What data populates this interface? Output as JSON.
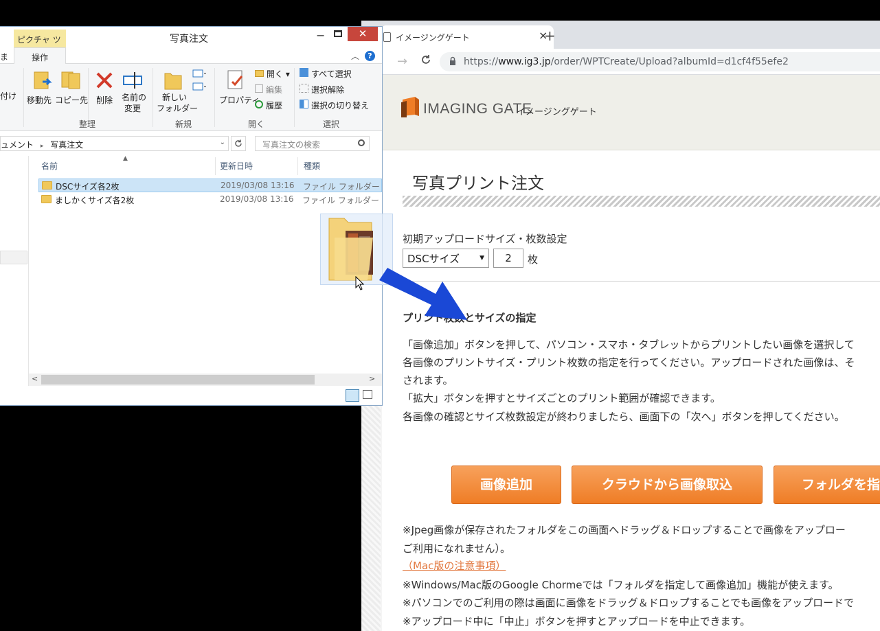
{
  "browser": {
    "tab_title": "イメージングゲート",
    "tab_close": "×",
    "new_tab": "+",
    "nav_back": "←",
    "nav_forward": "→",
    "nav_reload": "C",
    "url_scheme": "https://",
    "url_host": "www.ig3.jp",
    "url_path": "/order/WPTCreate/Upload?albumId=d1cf4f55efe2"
  },
  "site": {
    "logo_text": "IMAGING GATE",
    "logo_sub": "イメージングゲート",
    "page_title": "写真プリント注文",
    "upload_label": "初期アップロードサイズ・枚数設定",
    "size_value": "DSCサイズ",
    "count_value": "2",
    "count_unit": "枚",
    "section_heading": "プリント枚数とサイズの指定",
    "desc_lines": [
      "「画像追加」ボタンを押して、パソコン・スマホ・タブレットからプリントしたい画像を選択して",
      "各画像のプリントサイズ・プリント枚数の指定を行ってください。アップロードされた画像は、そ",
      "されます。",
      "「拡大」ボタンを押すとサイズごとのプリント範囲が確認できます。",
      "各画像の確認とサイズ枚数設定が終わりましたら、画面下の「次へ」ボタンを押してください。"
    ],
    "buttons": {
      "add_image": "画像追加",
      "cloud_import": "クラウドから画像取込",
      "folder_add": "フォルダを指"
    },
    "notes": [
      "※Jpeg画像が保存されたフォルダをこの画面へドラッグ＆ドロップすることで画像をアップロー",
      "ご利用になれません）。",
      "※Windows/Mac版のGoogle Chormeでは「フォルダを指定して画像追加」機能が使えます。",
      "※パソコンでのご利用の際は画面に画像をドラッグ＆ドロップすることでも画像をアップロードで",
      "※アップロード中に「中止」ボタンを押すとアップロードを中止できます。"
    ],
    "mac_link": "（Mac版の注意事項）"
  },
  "explorer": {
    "contextual_tab": "ピクチャ ツール",
    "title": "写真注文",
    "min": "−",
    "close": "✕",
    "tab_file_stub": "ま",
    "tab_manage": "操作",
    "help": "?",
    "ribbon": {
      "paste_stub": "付け",
      "move_to": "移動先",
      "copy_to": "コピー先",
      "delete": "削除",
      "rename_1": "名前の",
      "rename_2": "変更",
      "new_folder_1": "新しい",
      "new_folder_2": "フォルダー",
      "properties": "プロパティ",
      "open": "開く",
      "edit": "編集",
      "history": "履歴",
      "select_all": "すべて選択",
      "select_none": "選択解除",
      "invert_selection": "選択の切り替え",
      "group_organize": "整理",
      "group_new": "新規",
      "group_open": "開く",
      "group_select": "選択"
    },
    "address_prefix": "ュメント",
    "address_current": "写真注文",
    "search_placeholder": "写真注文の検索",
    "columns": {
      "name": "名前",
      "date": "更新日時",
      "type": "種類"
    },
    "files": [
      {
        "name": "DSCサイズ各2枚",
        "date": "2019/03/08 13:16",
        "type": "ファイル フォルダー",
        "selected": true
      },
      {
        "name": "ましかくサイズ各2枚",
        "date": "2019/03/08 13:16",
        "type": "ファイル フォルダー",
        "selected": false
      }
    ]
  },
  "colors": {
    "accent_orange": "#ef7d26",
    "arrow_blue": "#1a48d6",
    "close_red": "#c7463c",
    "link_orange": "#e2763c"
  }
}
